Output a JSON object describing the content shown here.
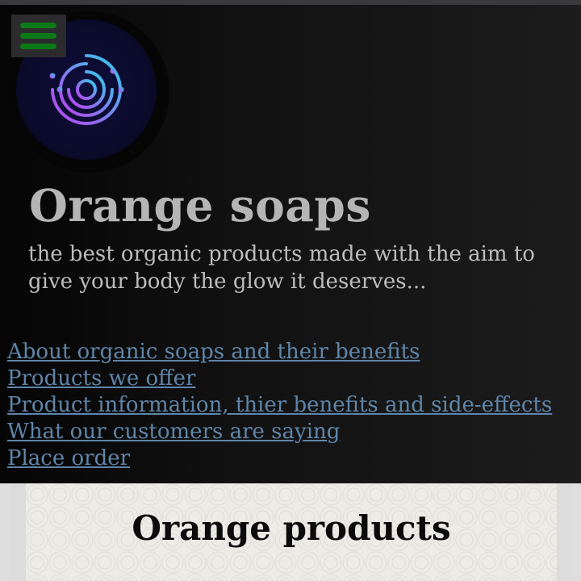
{
  "site": {
    "title": "Orange soaps",
    "tagline": "the best organic products made with the aim to give your body the glow it deserves..."
  },
  "nav": {
    "links": [
      "About organic soaps and their benefits",
      "Products we offer",
      "Product information, thier benefits and side-effects",
      "What our customers are saying",
      "Place order"
    ]
  },
  "section": {
    "title": "Orange products"
  },
  "icons": {
    "menu": "hamburger-menu-icon",
    "logo": "circular-circuit-logo-icon"
  },
  "colors": {
    "hero_background": "#111111",
    "title_text": "#b5b5b5",
    "link": "#5f85a9",
    "menu_bars": "#0b7a16",
    "logo_gradient_start": "#c03cf0",
    "logo_gradient_end": "#2fd0e8"
  }
}
